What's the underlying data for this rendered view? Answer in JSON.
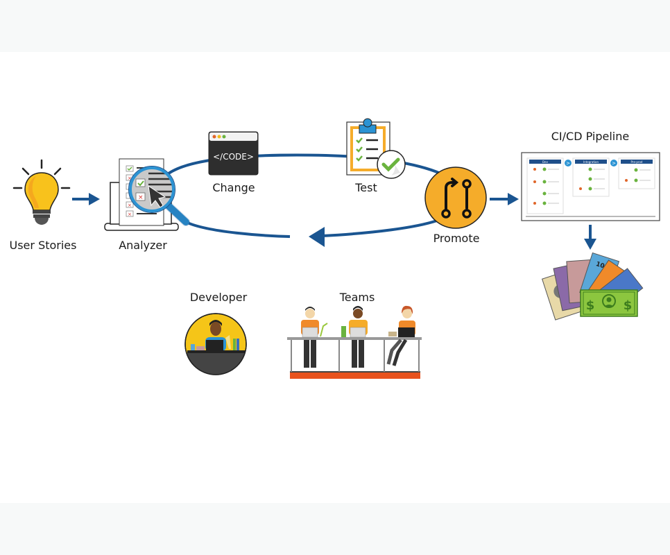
{
  "diagram": {
    "accent_color": "#1a5591",
    "highlight_color": "#f5ac2a",
    "nodes": {
      "user_stories": {
        "label": "User Stories",
        "icon": "lightbulb-icon"
      },
      "analyzer": {
        "label": "Analyzer",
        "icon": "magnifier-checklist-icon"
      },
      "change": {
        "label": "Change",
        "icon": "code-window-icon",
        "code_text": "</CODE>"
      },
      "test": {
        "label": "Test",
        "icon": "clipboard-check-icon"
      },
      "promote": {
        "label": "Promote",
        "icon": "git-pull-request-icon"
      },
      "pipeline": {
        "label": "CI/CD Pipeline",
        "icon": "pipeline-screenshot-icon",
        "stages": [
          "Dev",
          "Integration",
          "Pre-prod"
        ]
      },
      "money": {
        "icon": "money-bills-icon",
        "bill_value": "100"
      },
      "developer": {
        "label": "Developer",
        "icon": "developer-at-desk-icon"
      },
      "teams": {
        "label": "Teams",
        "icon": "team-at-desks-icon"
      }
    }
  }
}
